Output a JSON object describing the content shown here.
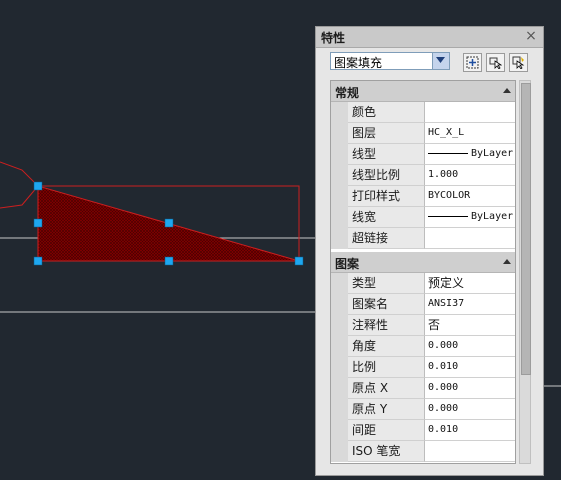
{
  "palette": {
    "title": "特性",
    "close_glyph": "×",
    "selected_object": "图案填充",
    "tool_icons": [
      "toggle-pickadd-icon",
      "select-objects-icon",
      "quick-select-icon"
    ]
  },
  "sections": [
    {
      "label": "常规",
      "rows": [
        {
          "name": "颜色",
          "value": ""
        },
        {
          "name": "图层",
          "value": "HC_X_L"
        },
        {
          "name": "线型",
          "value": "ByLayer",
          "line": true
        },
        {
          "name": "线型比例",
          "value": "1.000"
        },
        {
          "name": "打印样式",
          "value": "BYCOLOR"
        },
        {
          "name": "线宽",
          "value": "ByLayer",
          "line": true
        },
        {
          "name": "超链接",
          "value": ""
        }
      ]
    },
    {
      "label": "图案",
      "rows": [
        {
          "name": "类型",
          "value": "预定义",
          "cjk": true
        },
        {
          "name": "图案名",
          "value": "ANSI37"
        },
        {
          "name": "注释性",
          "value": "否",
          "cjk": true
        },
        {
          "name": "角度",
          "value": "0.000"
        },
        {
          "name": "比例",
          "value": "0.010"
        },
        {
          "name": "原点 X",
          "value": "0.000"
        },
        {
          "name": "原点 Y",
          "value": "0.000"
        },
        {
          "name": "间距",
          "value": "0.010"
        },
        {
          "name": "ISO 笔宽",
          "value": ""
        }
      ]
    }
  ],
  "colors": {
    "model_space_bg": "#212830",
    "hatch_fill": "#8b0000",
    "boundary": "#cc1f1f",
    "grip": "#1ea7f0"
  }
}
